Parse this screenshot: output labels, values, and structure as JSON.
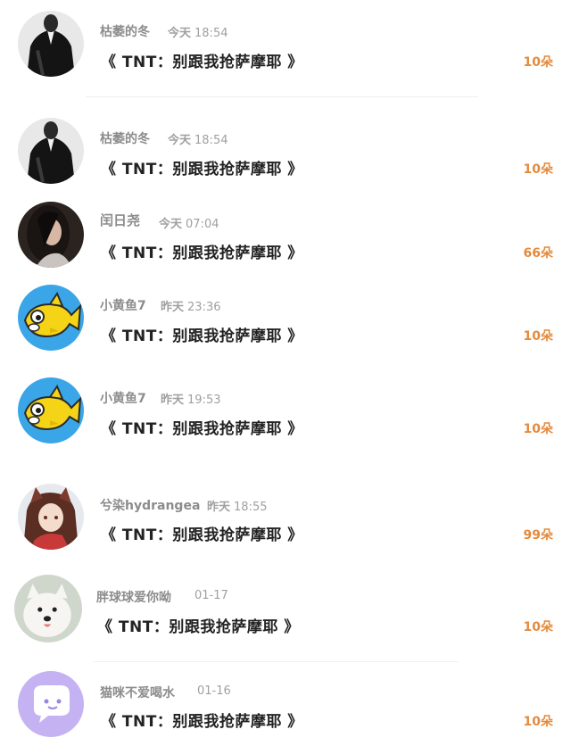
{
  "items": [
    {
      "username": "枯萎的冬",
      "day": "今天",
      "time": "18:54",
      "gift": "《 TNT：别跟我抢萨摩耶 》",
      "count": "10朵",
      "avatar": "avatar-dark-suit"
    },
    {
      "username": "枯萎的冬",
      "day": "今天",
      "time": "18:54",
      "gift": "《 TNT：别跟我抢萨摩耶 》",
      "count": "10朵",
      "avatar": "avatar-dark-suit"
    },
    {
      "username": "闰日尧",
      "day": "今天",
      "time": "07:04",
      "gift": "《 TNT：别跟我抢萨摩耶 》",
      "count": "66朵",
      "avatar": "avatar-girl-portrait"
    },
    {
      "username": "小黄鱼7",
      "day": "昨天",
      "time": "23:36",
      "gift": "《 TNT：别跟我抢萨摩耶 》",
      "count": "10朵",
      "avatar": "avatar-yellow-fish"
    },
    {
      "username": "小黄鱼7",
      "day": "昨天",
      "time": "19:53",
      "gift": "《 TNT：别跟我抢萨摩耶 》",
      "count": "10朵",
      "avatar": "avatar-yellow-fish"
    },
    {
      "username": "兮染hydrangea",
      "day": "昨天",
      "time": "18:55",
      "gift": "《 TNT：别跟我抢萨摩耶 》",
      "count": "99朵",
      "avatar": "avatar-anime-fox-girl"
    },
    {
      "username": "胖球球爱你呦",
      "day": "",
      "time": "01-17",
      "gift": "《 TNT：别跟我抢萨摩耶 》",
      "count": "10朵",
      "avatar": "avatar-white-dog"
    },
    {
      "username": "猫咪不爱喝水",
      "day": "",
      "time": "01-16",
      "gift": "《 TNT：别跟我抢萨摩耶 》",
      "count": "10朵",
      "avatar": "avatar-purple-chat-bubble"
    }
  ],
  "colors": {
    "username": "#8c8c8c",
    "time": "#a0a0a0",
    "gift": "#222222",
    "count": "#e58a3c",
    "divider": "#f0f0f0"
  }
}
